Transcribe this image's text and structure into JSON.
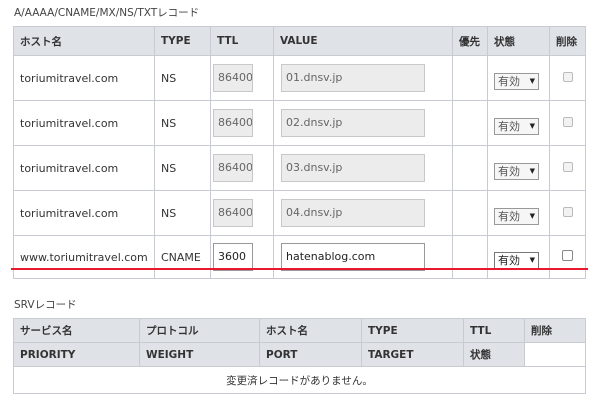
{
  "dns_section": {
    "title": "A/AAAA/CNAME/MX/NS/TXTレコード",
    "headers": {
      "host": "ホスト名",
      "type": "TYPE",
      "ttl": "TTL",
      "value": "VALUE",
      "priority": "優先",
      "status": "状態",
      "delete": "削除"
    },
    "records": [
      {
        "host": "toriumitravel.com",
        "type": "NS",
        "ttl": "86400",
        "value": "01.dnsv.jp",
        "status": "有効"
      },
      {
        "host": "toriumitravel.com",
        "type": "NS",
        "ttl": "86400",
        "value": "02.dnsv.jp",
        "status": "有効"
      },
      {
        "host": "toriumitravel.com",
        "type": "NS",
        "ttl": "86400",
        "value": "03.dnsv.jp",
        "status": "有効"
      },
      {
        "host": "toriumitravel.com",
        "type": "NS",
        "ttl": "86400",
        "value": "04.dnsv.jp",
        "status": "有効"
      },
      {
        "host": "www.toriumitravel.com",
        "type": "CNAME",
        "ttl": "3600",
        "value": "hatenablog.com",
        "status": "有効"
      }
    ]
  },
  "srv_section": {
    "title": "SRVレコード",
    "headers_row1": {
      "service": "サービス名",
      "protocol": "プロトコル",
      "host": "ホスト名",
      "type": "TYPE",
      "ttl": "TTL",
      "delete": "削除"
    },
    "headers_row2": {
      "priority": "PRIORITY",
      "weight": "WEIGHT",
      "port": "PORT",
      "target": "TARGET",
      "status": "状態"
    },
    "empty_message": "変更済レコードがありません。"
  },
  "colors": {
    "header_bg": "#dfe3e8",
    "border": "#c8ccd2",
    "highlight_line": "#e8192c"
  },
  "icons": {
    "dropdown": "triangle-down-icon",
    "checkbox": "checkbox-icon"
  }
}
